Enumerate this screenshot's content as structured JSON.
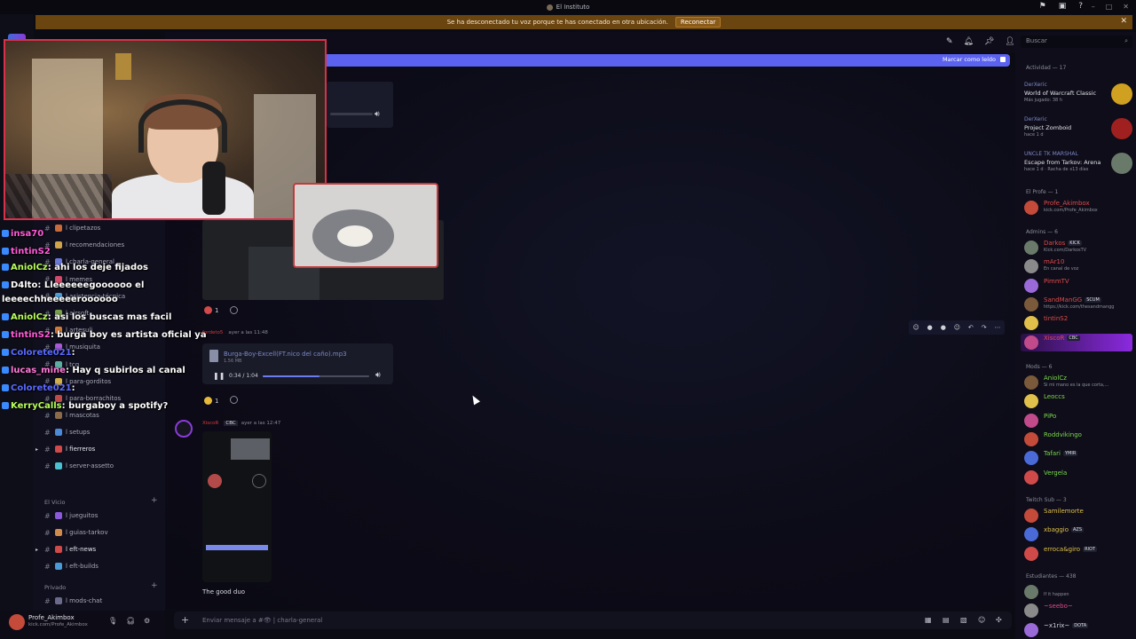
{
  "window": {
    "title": "El Instituto"
  },
  "notice": {
    "text": "Se ha desconectado tu voz porque te has conectado en otra ubicación.",
    "button": "Reconectar"
  },
  "topbar": {
    "mark_read": "Marcar como leído"
  },
  "search": {
    "placeholder": "Buscar"
  },
  "channels": {
    "items": [
      {
        "label": "l clipetazos",
        "color": "#c86a3a"
      },
      {
        "label": "l recomendaciones",
        "color": "#d0a24a"
      },
      {
        "label": "l charla-general",
        "color": "#6a7ad8"
      },
      {
        "label": "l memes",
        "color": "#d24a6a"
      },
      {
        "label": "l asistencia-técnica",
        "color": "#4aa0d8"
      },
      {
        "label": "l airsoft",
        "color": "#7aa04a"
      },
      {
        "label": "l artesuli",
        "color": "#d07a3a"
      },
      {
        "label": "l musiquita",
        "color": "#aa5ad8"
      },
      {
        "label": "l tcg",
        "color": "#5ab0a0"
      },
      {
        "label": "l para-gorditos",
        "color": "#d0b04a"
      },
      {
        "label": "l para-borrachitos",
        "color": "#c04a4a"
      },
      {
        "label": "l mascotas",
        "color": "#8a6a4a"
      },
      {
        "label": "l setups",
        "color": "#4a8ad8"
      },
      {
        "label": "l fierreros",
        "color": "#d04a4a"
      },
      {
        "label": "l server-assetto",
        "color": "#4ac0d0"
      }
    ],
    "category_vicio": "El Vicio",
    "vicio_items": [
      {
        "label": "l jueguitos",
        "color": "#8a5ad8"
      },
      {
        "label": "l guias-tarkov",
        "color": "#d08a4a"
      },
      {
        "label": "l eft-news",
        "color": "#d04a4a"
      },
      {
        "label": "l eft-builds",
        "color": "#4a9ad8"
      }
    ],
    "category_privado": "Privado",
    "privado_items": [
      {
        "label": "l mods-chat",
        "color": "#6a6a8a"
      }
    ]
  },
  "stream_chat": [
    {
      "user": "insa70",
      "text": "",
      "color": "#ff5ad8"
    },
    {
      "user": "tintinS2",
      "text": "",
      "color": "#ff5ad8"
    },
    {
      "user": "AniolCz",
      "text": ": ahi los deje fijados",
      "color": "#b8ff5a"
    },
    {
      "user": "D4lto",
      "text": ": Lleeeeeegoooooo el",
      "color": "#ffffff"
    },
    {
      "user": "",
      "text": "leeeechheeeeeroooooo",
      "color": "#ffffff"
    },
    {
      "user": "AniolCz",
      "text": ": asi los buscas mas facil",
      "color": "#b8ff5a"
    },
    {
      "user": "tintinS2",
      "text": ": burga boy es artista oficial ya",
      "color": "#ff5ad8"
    },
    {
      "user": "Colorete021",
      "text": ":",
      "color": "#5a6aff"
    },
    {
      "user": "lucas_mine",
      "text": ": Hay q subirlos al canal",
      "color": "#ff7ad8"
    },
    {
      "user": "Colorete021",
      "text": ":",
      "color": "#5a6aff"
    },
    {
      "user": "KerryCalls",
      "text": ": burgaboy a spotify?",
      "color": "#b8ff5a"
    }
  ],
  "messages": {
    "audio_msg": {
      "author": "fordeto5",
      "time": "ayer a las 11:48",
      "file_name": "Burga-Boy-Excell(FT.nico del caño).mp3",
      "file_size": "1.56 MB",
      "current": "0:34",
      "duration": "1:04",
      "progress": 0.53
    },
    "image_reaction": {
      "count": "1"
    },
    "audio_reaction": {
      "count": "1"
    },
    "third_msg": {
      "author": "XiscoR",
      "tag": "CBC",
      "time": "ayer a las 12:47",
      "caption": "The good duo"
    }
  },
  "composer": {
    "placeholder": "Enviar mensaje a #👁 | charla-general"
  },
  "user": {
    "name": "Profe_Akimbox",
    "status": "kick.com/Profe_Akimbox"
  },
  "members": {
    "activity_header": "Actividad — 17",
    "activities": [
      {
        "name": "DerXeric",
        "game": "World of Warcraft Classic",
        "sub": "Más jugado: 38 h",
        "color": "#d0a020"
      },
      {
        "name": "DerXeric",
        "game": "Project Zomboid",
        "sub": "hace 1 d",
        "color": "#a02020"
      },
      {
        "name": "UNCLE TK MARSHAL",
        "game": "Escape from Tarkov: Arena",
        "sub": "hace 1 d · Racha de x13 días",
        "color": "#6a7a6a"
      }
    ],
    "groups": [
      {
        "title": "El Profe — 1",
        "items": [
          {
            "name": "Profe_Akimbox",
            "sub": "kick.com/Profe_Akimbox",
            "color": "#e04a4a",
            "tag": ""
          }
        ]
      },
      {
        "title": "Admins — 6",
        "items": [
          {
            "name": "Darkos",
            "sub": "Kick.com/DarkosTV",
            "color": "#e04a4a",
            "tag": "KICK"
          },
          {
            "name": "mAr10",
            "sub": "En canal de voz",
            "color": "#e04a4a",
            "tag": ""
          },
          {
            "name": "PimmTV",
            "sub": "",
            "color": "#e04a4a",
            "tag": ""
          },
          {
            "name": "SandManGG",
            "sub": "https://kick.com/thesandmangg",
            "color": "#e04a4a",
            "tag": "SCUM"
          },
          {
            "name": "tintinS2",
            "sub": "",
            "color": "#e04a4a",
            "tag": ""
          },
          {
            "name": "XiscoR",
            "sub": "",
            "color": "#e04a4a",
            "tag": "CBC"
          }
        ]
      },
      {
        "title": "Mods — 6",
        "items": [
          {
            "name": "AniolCz",
            "sub": "Si mi mano es la que corta,...",
            "color": "#7ad84a",
            "tag": ""
          },
          {
            "name": "Leoccs",
            "sub": "",
            "color": "#7ad84a",
            "tag": ""
          },
          {
            "name": "PiPo",
            "sub": "",
            "color": "#7ad84a",
            "tag": ""
          },
          {
            "name": "Roddvikingo",
            "sub": "",
            "color": "#7ad84a",
            "tag": ""
          },
          {
            "name": "Tafari",
            "sub": "",
            "color": "#7ad84a",
            "tag": "YMIR"
          },
          {
            "name": "Vergela",
            "sub": "",
            "color": "#7ad84a",
            "tag": ""
          }
        ]
      },
      {
        "title": "Twitch Sub — 3",
        "items": [
          {
            "name": "Samilemorte",
            "sub": "",
            "color": "#e0c04a",
            "tag": ""
          },
          {
            "name": "xbaggio",
            "sub": "",
            "color": "#e0c04a",
            "tag": "AZS"
          },
          {
            "name": "erroca&giro",
            "sub": "",
            "color": "#e0c04a",
            "tag": "RIOT"
          }
        ]
      },
      {
        "title": "Estudiantes — 438",
        "items": [
          {
            "name": "",
            "sub": "If it happen",
            "color": "#c0c0d0",
            "tag": ""
          },
          {
            "name": "~seebo~",
            "sub": "",
            "color": "#e04a8a",
            "tag": ""
          },
          {
            "name": "~x1rix~",
            "sub": "",
            "color": "#d0d0e0",
            "tag": "DOTA"
          }
        ]
      }
    ]
  }
}
